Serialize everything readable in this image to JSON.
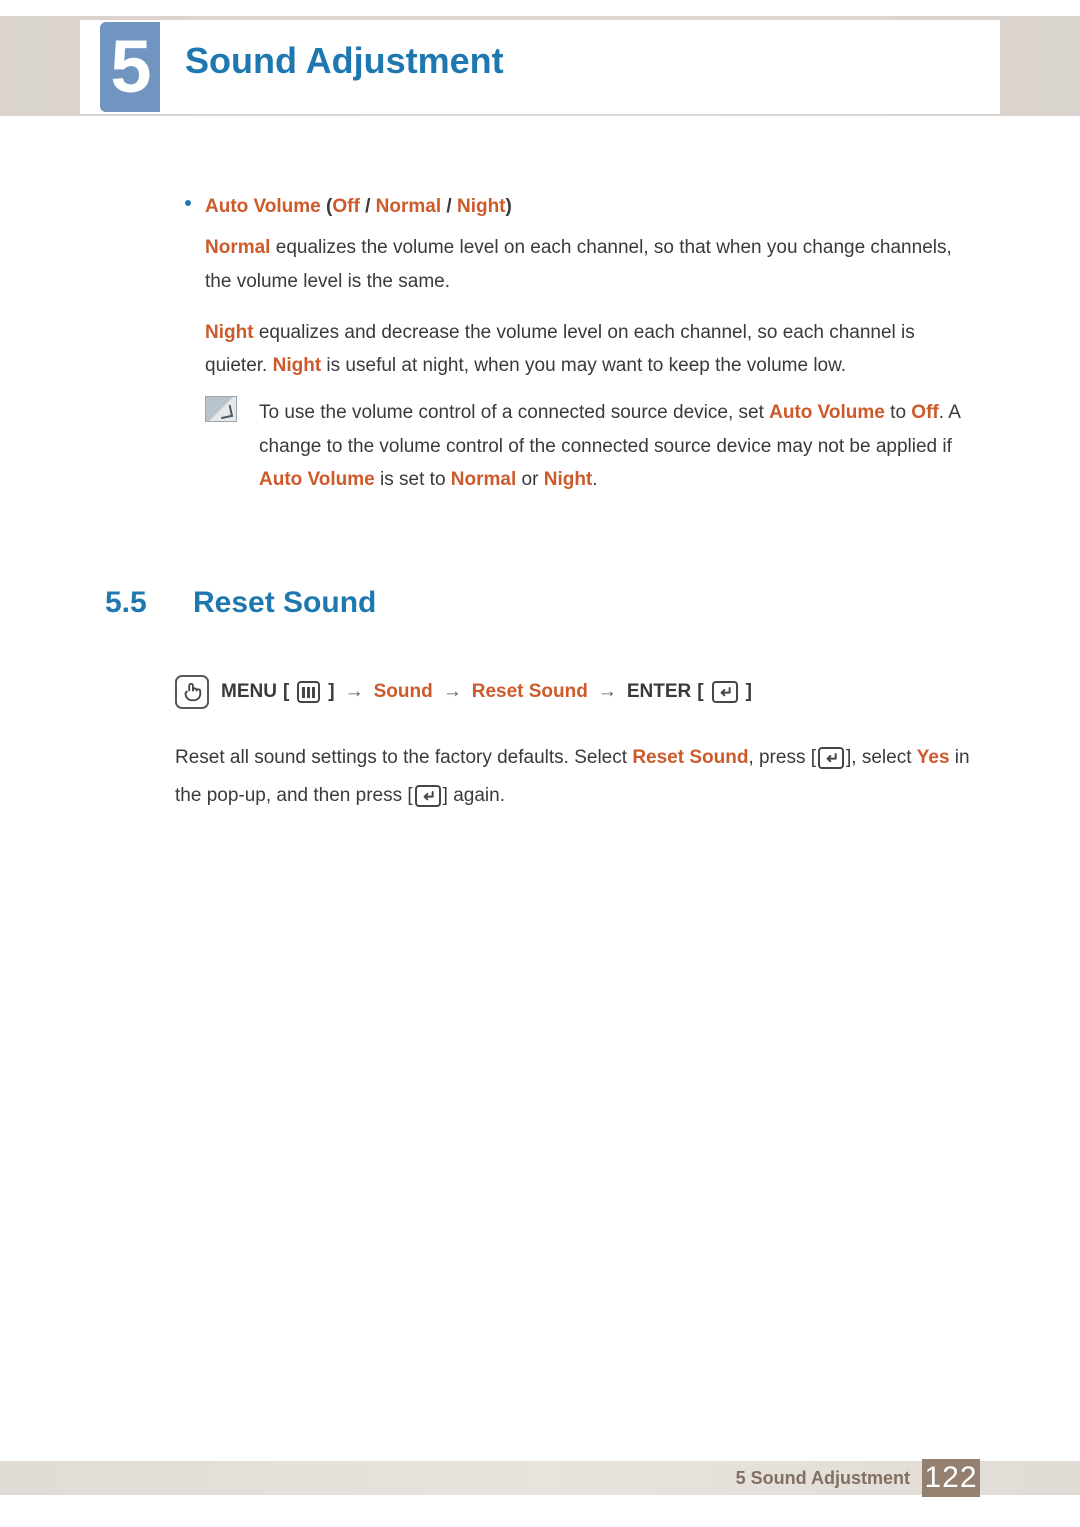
{
  "header": {
    "chapter_num": "5",
    "chapter_title": "Sound Adjustment"
  },
  "auto_volume": {
    "label": "Auto Volume",
    "opt_off": "Off",
    "opt_normal": "Normal",
    "opt_night": "Night",
    "p_normal_lead": "Normal",
    "p_normal_rest": " equalizes the volume level on each channel, so that when you change channels, the volume level is the same.",
    "p_night_lead": "Night",
    "p_night_mid": " equalizes and decrease the volume level on each channel, so each channel is quieter. ",
    "p_night_lead2": "Night",
    "p_night_rest": " is useful at night, when you may want to keep the volume low.",
    "note_a": "To use the volume control of a connected source device, set ",
    "note_av1": "Auto Volume",
    "note_b": " to ",
    "note_off": "Off",
    "note_c": ". A change to the volume control of the connected source device may not be applied if ",
    "note_av2": "Auto Volume",
    "note_d": " is set to ",
    "note_normal": "Normal",
    "note_e": " or ",
    "note_night": "Night",
    "note_f": "."
  },
  "section": {
    "num": "5.5",
    "title": "Reset Sound"
  },
  "nav": {
    "menu": "MENU",
    "sound": "Sound",
    "reset": "Reset Sound",
    "enter": "ENTER"
  },
  "reset_body": {
    "a": "Reset all sound settings to the factory defaults. Select ",
    "b": "Reset Sound",
    "c": ", press [",
    "d": "], select ",
    "e": "Yes",
    "f": " in the pop-up, and then press [",
    "g": "] again."
  },
  "footer": {
    "text": "5 Sound Adjustment",
    "page": "122"
  }
}
